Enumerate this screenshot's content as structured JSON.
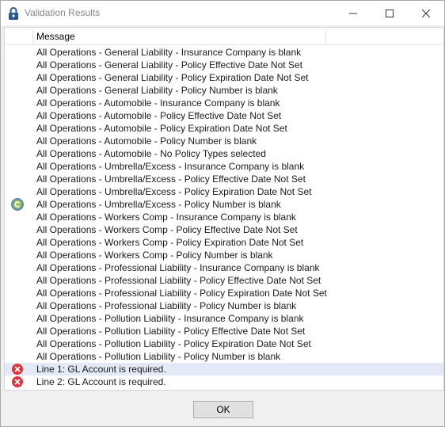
{
  "window": {
    "title": "Validation Results",
    "title_color": "#888888",
    "titlebar_icons": [
      "lock-icon",
      "minimize-icon",
      "maximize-icon",
      "close-icon"
    ]
  },
  "list": {
    "header": {
      "message": "Message"
    },
    "rows": [
      {
        "text": "All Operations - General Liability - Insurance Company is blank",
        "icon": ""
      },
      {
        "text": "All Operations - General Liability - Policy Effective Date Not Set",
        "icon": ""
      },
      {
        "text": "All Operations - General Liability - Policy Expiration Date Not Set",
        "icon": ""
      },
      {
        "text": "All Operations - General Liability - Policy Number is blank",
        "icon": ""
      },
      {
        "text": "All Operations - Automobile - Insurance Company is blank",
        "icon": ""
      },
      {
        "text": "All Operations - Automobile - Policy Effective Date Not Set",
        "icon": ""
      },
      {
        "text": "All Operations - Automobile - Policy Expiration Date Not Set",
        "icon": ""
      },
      {
        "text": "All Operations - Automobile - Policy Number is blank",
        "icon": ""
      },
      {
        "text": "All Operations - Automobile - No Policy Types selected",
        "icon": ""
      },
      {
        "text": "All Operations - Umbrella/Excess - Insurance Company is blank",
        "icon": ""
      },
      {
        "text": "All Operations - Umbrella/Excess - Policy Effective Date Not Set",
        "icon": ""
      },
      {
        "text": "All Operations - Umbrella/Excess - Policy Expiration Date Not Set",
        "icon": ""
      },
      {
        "text": "All Operations - Umbrella/Excess - Policy Number is blank",
        "icon": ""
      },
      {
        "text": "All Operations - Workers Comp - Insurance Company is blank",
        "icon": ""
      },
      {
        "text": "All Operations - Workers Comp - Policy Effective Date Not Set",
        "icon": ""
      },
      {
        "text": "All Operations - Workers Comp - Policy Expiration Date Not Set",
        "icon": ""
      },
      {
        "text": "All Operations - Workers Comp - Policy Number is blank",
        "icon": ""
      },
      {
        "text": "All Operations - Professional Liability - Insurance Company is blank",
        "icon": ""
      },
      {
        "text": "All Operations - Professional Liability - Policy Effective Date Not Set",
        "icon": ""
      },
      {
        "text": "All Operations - Professional Liability - Policy Expiration Date Not Set",
        "icon": ""
      },
      {
        "text": "All Operations - Professional Liability - Policy Number is blank",
        "icon": ""
      },
      {
        "text": "All Operations - Pollution Liability - Insurance Company is blank",
        "icon": ""
      },
      {
        "text": "All Operations - Pollution Liability - Policy Effective Date Not Set",
        "icon": ""
      },
      {
        "text": "All Operations - Pollution Liability - Policy Expiration Date Not Set",
        "icon": ""
      },
      {
        "text": "All Operations - Pollution Liability - Policy Number is blank",
        "icon": ""
      },
      {
        "text": "Line 1: GL Account is required.",
        "icon": "error-icon",
        "selected": true
      },
      {
        "text": "Line 2: GL Account is required.",
        "icon": "error-icon"
      }
    ],
    "side_icon": "app-logo-icon",
    "selected_row_color": "#e5e9f7",
    "error_color": "#d9363e"
  },
  "footer": {
    "ok_label": "OK"
  }
}
